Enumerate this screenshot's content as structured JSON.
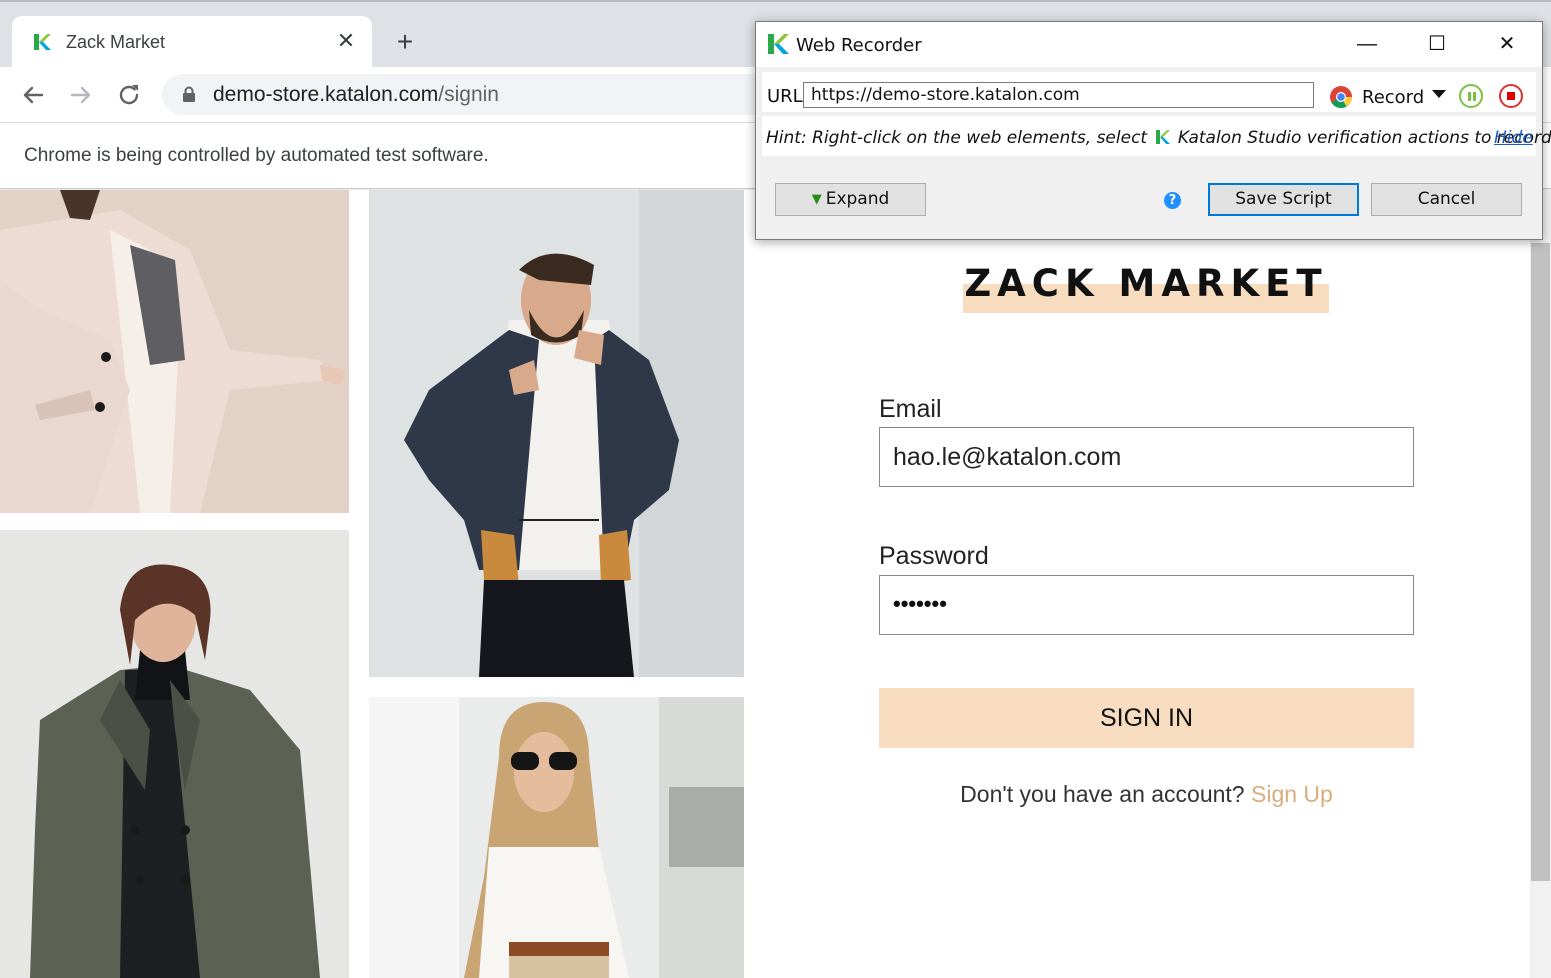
{
  "browser": {
    "tab": {
      "title": "Zack Market",
      "close_glyph": "✕"
    },
    "new_tab_glyph": "+",
    "omnibox": {
      "host": "demo-store.katalon.com",
      "path": "/signin"
    },
    "infobar": "Chrome is being controlled by automated test software."
  },
  "page": {
    "brand": "ZACK MARKET",
    "email": {
      "label": "Email",
      "value": "hao.le@katalon.com"
    },
    "password": {
      "label": "Password",
      "masked": "•••••••"
    },
    "signin_label": "SIGN IN",
    "signup_prompt": "Don't you have an account?",
    "signup_link": "Sign Up",
    "accent_color": "#f7dcc0",
    "link_color": "#d9ad7c"
  },
  "recorder": {
    "title": "Web Recorder",
    "window_controls": {
      "minimize": "—",
      "maximize": "☐",
      "close": "✕"
    },
    "url_label": "URL",
    "url_value": "https://demo-store.katalon.com",
    "record_label": "Record",
    "hint_before": "Hint: Right-click on the web elements, select",
    "hint_after": "Katalon Studio verification actions to record",
    "hide_link": "Hide",
    "expand_label": "Expand",
    "help_glyph": "?",
    "save_label": "Save Script",
    "cancel_label": "Cancel"
  }
}
